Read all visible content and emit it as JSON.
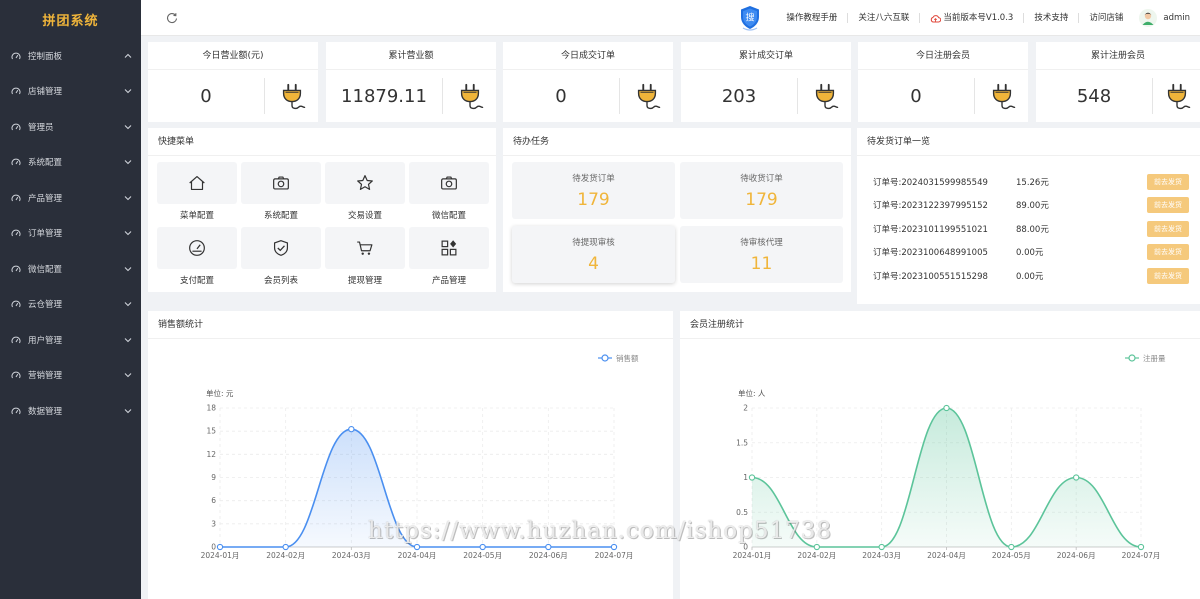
{
  "app": {
    "title": "拼团系统"
  },
  "sidebar": {
    "items": [
      {
        "label": "控制面板",
        "icon": "dashboard-icon",
        "expanded": true
      },
      {
        "label": "店铺管理",
        "icon": "shop-icon"
      },
      {
        "label": "管理员",
        "icon": "admin-icon"
      },
      {
        "label": "系统配置",
        "icon": "settings-icon"
      },
      {
        "label": "产品管理",
        "icon": "product-icon"
      },
      {
        "label": "订单管理",
        "icon": "order-icon"
      },
      {
        "label": "微信配置",
        "icon": "wechat-icon"
      },
      {
        "label": "云仓管理",
        "icon": "warehouse-icon"
      },
      {
        "label": "用户管理",
        "icon": "user-icon"
      },
      {
        "label": "营销管理",
        "icon": "marketing-icon"
      },
      {
        "label": "数据管理",
        "icon": "data-icon"
      }
    ]
  },
  "header": {
    "links": [
      "操作教程手册",
      "关注八六互联",
      "当前版本号V1.0.3",
      "技术支持",
      "访问店铺"
    ],
    "user": "admin"
  },
  "stats": [
    {
      "title": "今日营业额(元)",
      "value": "0"
    },
    {
      "title": "累计营业额",
      "value": "11879.11"
    },
    {
      "title": "今日成交订单",
      "value": "0"
    },
    {
      "title": "累计成交订单",
      "value": "203"
    },
    {
      "title": "今日注册会员",
      "value": "0"
    },
    {
      "title": "累计注册会员",
      "value": "548"
    }
  ],
  "quick": {
    "title": "快捷菜单",
    "items": [
      {
        "label": "菜单配置",
        "icon": "home-icon"
      },
      {
        "label": "系统配置",
        "icon": "camera-icon"
      },
      {
        "label": "交易设置",
        "icon": "star-icon"
      },
      {
        "label": "微信配置",
        "icon": "camera-icon"
      },
      {
        "label": "支付配置",
        "icon": "gauge-icon"
      },
      {
        "label": "会员列表",
        "icon": "shield-check-icon"
      },
      {
        "label": "提现管理",
        "icon": "cart-icon"
      },
      {
        "label": "产品管理",
        "icon": "apps-icon"
      }
    ]
  },
  "tasks": {
    "title": "待办任务",
    "items": [
      {
        "label": "待发货订单",
        "value": "179"
      },
      {
        "label": "待收货订单",
        "value": "179"
      },
      {
        "label": "待提现审核",
        "value": "4"
      },
      {
        "label": "待审核代理",
        "value": "11"
      }
    ]
  },
  "pending_orders": {
    "title": "待发货订单一览",
    "button_label": "前去发货",
    "rows": [
      {
        "no": "订单号:2024031599985549",
        "amount": "15.26元"
      },
      {
        "no": "订单号:2023122397995152",
        "amount": "89.00元"
      },
      {
        "no": "订单号:2023101199551021",
        "amount": "88.00元"
      },
      {
        "no": "订单号:2023100648991005",
        "amount": "0.00元"
      },
      {
        "no": "订单号:2023100551515298",
        "amount": "0.00元"
      }
    ]
  },
  "colors": {
    "accent": "#f0b53a",
    "sidebar_bg": "#2a2f3a",
    "sales_line": "#4a8ff0",
    "member_line": "#5cc49a"
  },
  "watermark": "https://www.huzhan.com/ishop51738",
  "chart_data": [
    {
      "type": "area",
      "title": "销售额统计",
      "unit_label": "单位: 元",
      "x": [
        "2024-01月",
        "2024-02月",
        "2024-03月",
        "2024-04月",
        "2024-05月",
        "2024-06月",
        "2024-07月"
      ],
      "series": [
        {
          "name": "销售额",
          "values": [
            0,
            0,
            15.26,
            0,
            0,
            0,
            0
          ]
        }
      ],
      "yticks": [
        0,
        3,
        6,
        9,
        12,
        15,
        18
      ],
      "ylim": [
        0,
        18
      ],
      "grid": true,
      "legend": "top-right",
      "smooth": true
    },
    {
      "type": "area",
      "title": "会员注册统计",
      "unit_label": "单位: 人",
      "x": [
        "2024-01月",
        "2024-02月",
        "2024-03月",
        "2024-04月",
        "2024-05月",
        "2024-06月",
        "2024-07月"
      ],
      "series": [
        {
          "name": "注册量",
          "values": [
            1,
            0,
            0,
            2,
            0,
            1,
            0
          ]
        }
      ],
      "yticks": [
        0,
        0.5,
        1,
        1.5,
        2
      ],
      "ylim": [
        0,
        2
      ],
      "grid": true,
      "legend": "top-right",
      "smooth": true
    }
  ]
}
